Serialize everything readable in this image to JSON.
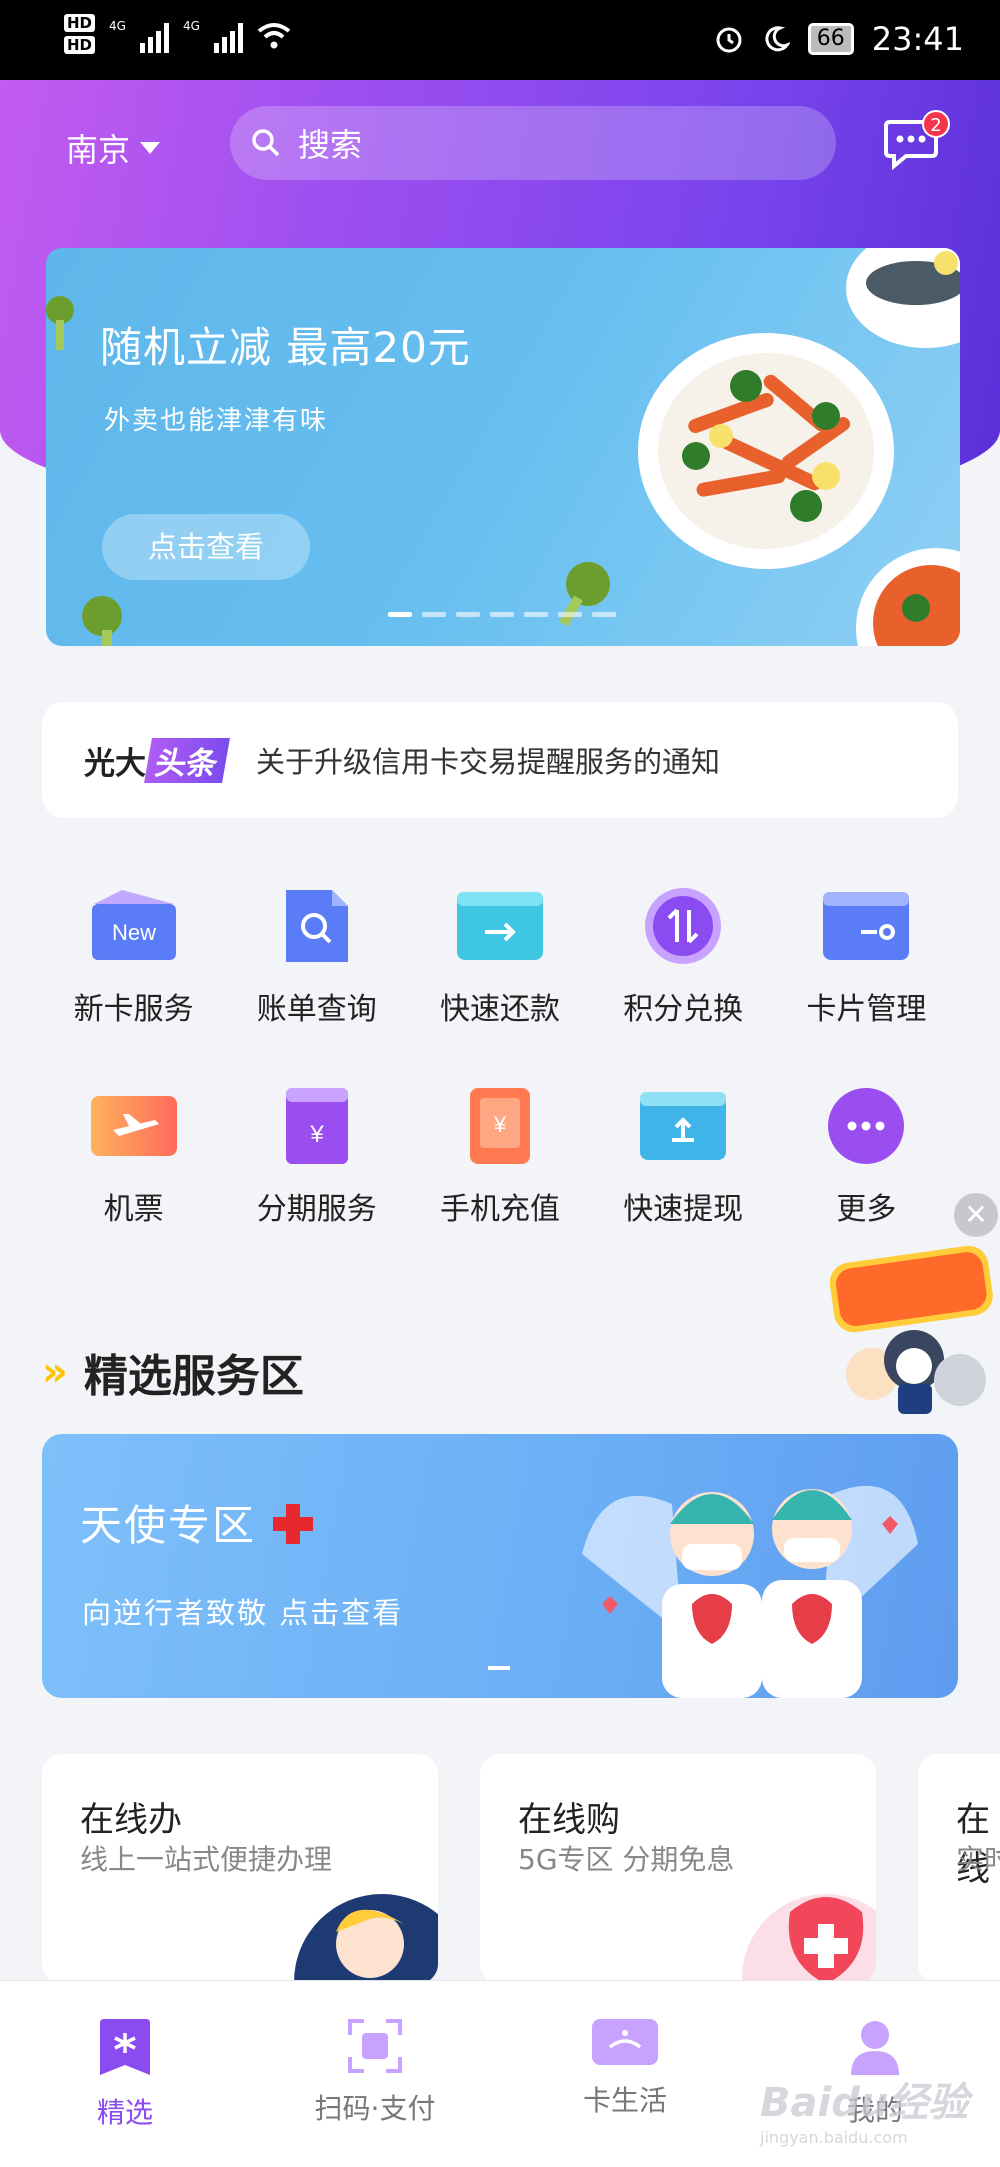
{
  "status_bar": {
    "network_1": "4G",
    "network_2": "4G",
    "battery": "66",
    "time": "23:41"
  },
  "header": {
    "city": "南京",
    "search_placeholder": "搜索",
    "message_badge": "2"
  },
  "banner": {
    "title": "随机立减  最高20元",
    "subtitle": "外卖也能津津有味",
    "button": "点击查看"
  },
  "news": {
    "brand_left": "光大",
    "brand_right": "头条",
    "text": "关于升级信用卡交易提醒服务的通知"
  },
  "services": [
    {
      "label": "新卡服务",
      "icon": "new-card-icon",
      "badge": "New"
    },
    {
      "label": "账单查询",
      "icon": "bill-search-icon"
    },
    {
      "label": "快速还款",
      "icon": "quick-repay-icon"
    },
    {
      "label": "积分兑换",
      "icon": "points-exchange-icon"
    },
    {
      "label": "卡片管理",
      "icon": "card-manage-icon"
    },
    {
      "label": "机票",
      "icon": "flight-icon"
    },
    {
      "label": "分期服务",
      "icon": "installment-icon"
    },
    {
      "label": "手机充值",
      "icon": "phone-topup-icon"
    },
    {
      "label": "快速提现",
      "icon": "cash-withdraw-icon"
    },
    {
      "label": "更多",
      "icon": "more-icon"
    }
  ],
  "section": {
    "title": "精选服务区"
  },
  "angel": {
    "title": "天使专区",
    "subtitle": "向逆行者致敬    点击查看"
  },
  "cards": [
    {
      "title": "在线办",
      "subtitle": "线上一站式便捷办理"
    },
    {
      "title": "在线购",
      "subtitle": "5G专区  分期免息"
    },
    {
      "title": "在线",
      "subtitle": "实时"
    }
  ],
  "tabs": [
    {
      "label": "精选",
      "icon": "featured-icon",
      "active": true
    },
    {
      "label": "扫码·支付",
      "icon": "scan-pay-icon",
      "active": false
    },
    {
      "label": "卡生活",
      "icon": "card-life-icon",
      "active": false
    },
    {
      "label": "我的",
      "icon": "profile-icon",
      "active": false
    }
  ],
  "watermark": {
    "brand": "Baidu经验",
    "url": "jingyan.baidu.com"
  },
  "colors": {
    "accent": "#8a4cf0",
    "banner": "#67bff0",
    "badge": "#f4364c"
  }
}
